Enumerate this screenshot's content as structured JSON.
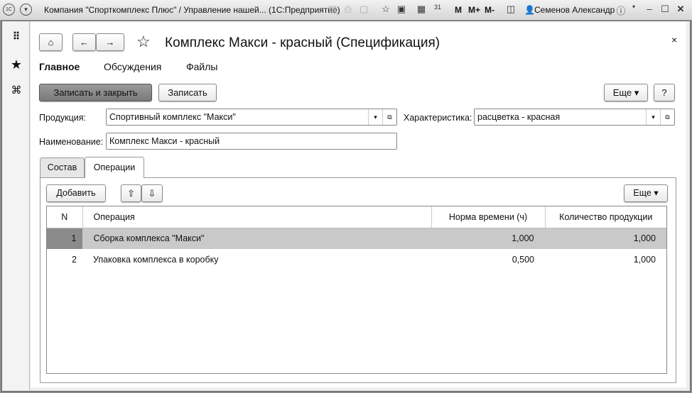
{
  "titlebar": {
    "title": "Компания \"Спорткомплекс Плюс\" / Управление нашей...  (1С:Предприятие)",
    "memory": [
      "M",
      "M+",
      "M-"
    ],
    "user": "Семенов Александр"
  },
  "form": {
    "title": "Комплекс Макси - красный (Спецификация)",
    "nav": [
      "Главное",
      "Обсуждения",
      "Файлы"
    ],
    "save_close": "Записать и закрыть",
    "save": "Записать",
    "more": "Еще",
    "help": "?",
    "product_label": "Продукция:",
    "product_value": "Спортивный комплекс \"Макси\"",
    "char_label": "Характеристика:",
    "char_value": "расцветка - красная",
    "name_label": "Наименование:",
    "name_value": "Комплекс Макси - красный",
    "tabs": [
      "Состав",
      "Операции"
    ],
    "add": "Добавить",
    "table_more": "Еще",
    "columns": [
      "N",
      "Операция",
      "Норма времени (ч)",
      "Количество продукции"
    ],
    "rows": [
      {
        "n": "1",
        "op": "Сборка комплекса \"Макси\"",
        "norm": "1,000",
        "qty": "1,000"
      },
      {
        "n": "2",
        "op": "Упаковка комплекса в коробку",
        "norm": "0,500",
        "qty": "1,000"
      }
    ]
  }
}
